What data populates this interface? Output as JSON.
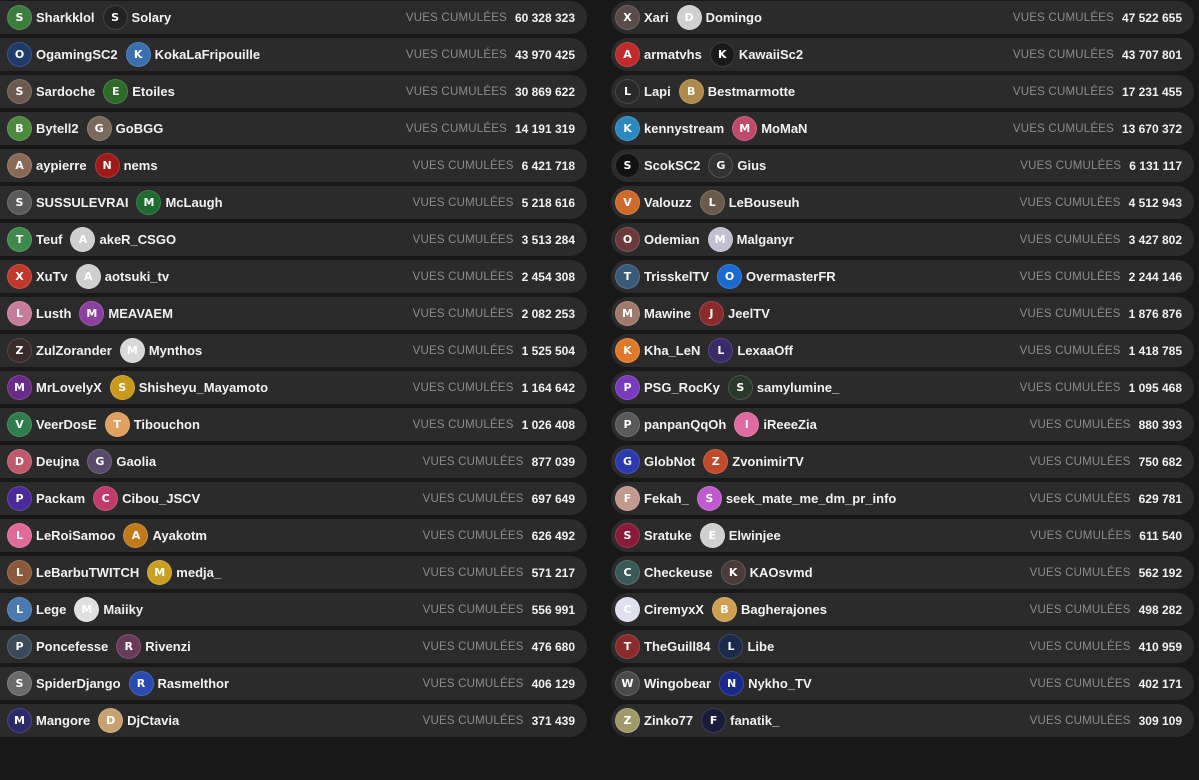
{
  "stat_label": "VUES CUMULÉES",
  "left_rows": [
    {
      "a": "Sharkklol",
      "b": "Solary",
      "views": "60 328 323",
      "ca": "#3c7d3e",
      "cb": "#222222"
    },
    {
      "a": "OgamingSC2",
      "b": "KokaLaFripouille",
      "views": "43 970 425",
      "ca": "#1f3b6b",
      "cb": "#3a6fb0"
    },
    {
      "a": "Sardoche",
      "b": "Etoiles",
      "views": "30 869 622",
      "ca": "#6b5a4d",
      "cb": "#2e6b2a"
    },
    {
      "a": "Bytell2",
      "b": "GoBGG",
      "views": "14 191 319",
      "ca": "#4c8a3c",
      "cb": "#7a6a5c"
    },
    {
      "a": "aypierre",
      "b": "nems",
      "views": "6 421 718",
      "ca": "#8a6a55",
      "cb": "#a01a1a"
    },
    {
      "a": "SUSSULEVRAI",
      "b": "McLaugh",
      "views": "5 218 616",
      "ca": "#5a5a5a",
      "cb": "#1e6b2e"
    },
    {
      "a": "Teuf",
      "b": "akeR_CSGO",
      "views": "3 513 284",
      "ca": "#3e8a4a",
      "cb": "#cfcfcf"
    },
    {
      "a": "XuTv",
      "b": "aotsuki_tv",
      "views": "2 454 308",
      "ca": "#c0392b",
      "cb": "#cfcfcf"
    },
    {
      "a": "Lusth",
      "b": "MEAVAEM",
      "views": "2 082 253",
      "ca": "#c77d9a",
      "cb": "#8b3fa0"
    },
    {
      "a": "ZulZorander",
      "b": "Mynthos",
      "views": "1 525 504",
      "ca": "#3b2b2b",
      "cb": "#d9d9d9"
    },
    {
      "a": "MrLovelyX",
      "b": "Shisheyu_Mayamoto",
      "views": "1 164 642",
      "ca": "#6a2a8a",
      "cb": "#c99a1a"
    },
    {
      "a": "VeerDosE",
      "b": "Tibouchon",
      "views": "1 026 408",
      "ca": "#2e7d4a",
      "cb": "#e0a060"
    },
    {
      "a": "Deujna",
      "b": "Gaolia",
      "views": "877 039",
      "ca": "#c05a6a",
      "cb": "#5a4a6a"
    },
    {
      "a": "Packam",
      "b": "Cibou_JSCV",
      "views": "697 649",
      "ca": "#4a2a9a",
      "cb": "#c03a6a"
    },
    {
      "a": "LeRoiSamoo",
      "b": "Ayakotm",
      "views": "626 492",
      "ca": "#e06a9a",
      "cb": "#c07a1a"
    },
    {
      "a": "LeBarbuTWITCH",
      "b": "medja_",
      "views": "571 217",
      "ca": "#8a5a3a",
      "cb": "#c9a020"
    },
    {
      "a": "Lege",
      "b": "Maiiky",
      "views": "556 991",
      "ca": "#4a7ab0",
      "cb": "#e0e0e0"
    },
    {
      "a": "Poncefesse",
      "b": "Rivenzi",
      "views": "476 680",
      "ca": "#3a4a5a",
      "cb": "#6a3a5a"
    },
    {
      "a": "SpiderDjango",
      "b": "Rasmelthor",
      "views": "406 129",
      "ca": "#6a6a6a",
      "cb": "#2a4ab0"
    },
    {
      "a": "Mangore",
      "b": "DjCtavia",
      "views": "371 439",
      "ca": "#2a2a6a",
      "cb": "#c9a070"
    }
  ],
  "right_rows": [
    {
      "a": "Xari",
      "b": "Domingo",
      "views": "47 522 655",
      "ca": "#5a4a4a",
      "cb": "#d0d0d0"
    },
    {
      "a": "armatvhs",
      "b": "KawaiiSc2",
      "views": "43 707 801",
      "ca": "#c02a2a",
      "cb": "#1a1a1a"
    },
    {
      "a": "Lapi",
      "b": "Bestmarmotte",
      "views": "17 231 455",
      "ca": "#2a2a2a",
      "cb": "#b08a4a"
    },
    {
      "a": "kennystream",
      "b": "MoMaN",
      "views": "13 670 372",
      "ca": "#2a8ac0",
      "cb": "#c04a6a"
    },
    {
      "a": "ScokSC2",
      "b": "Gius",
      "views": "6 131 117",
      "ca": "#111111",
      "cb": "#333333"
    },
    {
      "a": "Valouzz",
      "b": "LeBouseuh",
      "views": "4 512 943",
      "ca": "#d06a2a",
      "cb": "#6a5a4a"
    },
    {
      "a": "Odemian",
      "b": "Malganyr",
      "views": "3 427 802",
      "ca": "#6a3a3a",
      "cb": "#c0c0d0"
    },
    {
      "a": "TrisskelTV",
      "b": "OvermasterFR",
      "views": "2 244 146",
      "ca": "#3a5a7a",
      "cb": "#1a6ad0"
    },
    {
      "a": "Mawine",
      "b": "JeelTV",
      "views": "1 876 876",
      "ca": "#a07a6a",
      "cb": "#8a2a2a"
    },
    {
      "a": "Kha_LeN",
      "b": "LexaaOff",
      "views": "1 418 785",
      "ca": "#e07a2a",
      "cb": "#3a2a6a"
    },
    {
      "a": "PSG_RocKy",
      "b": "samylumine_",
      "views": "1 095 468",
      "ca": "#7a3ac0",
      "cb": "#2a3a2a"
    },
    {
      "a": "panpanQqOh",
      "b": "iReeeZia",
      "views": "880 393",
      "ca": "#5a5a5a",
      "cb": "#e06aa0"
    },
    {
      "a": "GlobNot",
      "b": "ZvonimirTV",
      "views": "750 682",
      "ca": "#2a3ab0",
      "cb": "#c04a2a"
    },
    {
      "a": "Fekah_",
      "b": "seek_mate_me_dm_pr_info",
      "views": "629 781",
      "ca": "#c09a8a",
      "cb": "#c05ad0"
    },
    {
      "a": "Sratuke",
      "b": "Elwinjee",
      "views": "611 540",
      "ca": "#8a1a3a",
      "cb": "#d0d0d0"
    },
    {
      "a": "Checkeuse",
      "b": "KAOsvmd",
      "views": "562 192",
      "ca": "#3a5a5a",
      "cb": "#4a3a3a"
    },
    {
      "a": "CiremyxX",
      "b": "Bagherajones",
      "views": "498 282",
      "ca": "#e0e0f0",
      "cb": "#d0a050"
    },
    {
      "a": "TheGuill84",
      "b": "Libe",
      "views": "410 959",
      "ca": "#8a2a2a",
      "cb": "#1a2a4a"
    },
    {
      "a": "Wingobear",
      "b": "Nykho_TV",
      "views": "402 171",
      "ca": "#4a4a4a",
      "cb": "#1a2a8a"
    },
    {
      "a": "Zinko77",
      "b": "fanatik_",
      "views": "309 109",
      "ca": "#a09a6a",
      "cb": "#1a1a3a"
    }
  ]
}
